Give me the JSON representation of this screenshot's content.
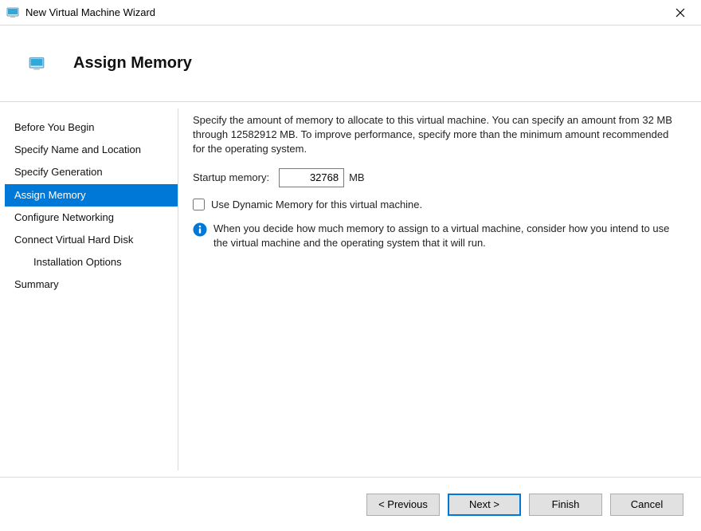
{
  "window": {
    "title": "New Virtual Machine Wizard"
  },
  "header": {
    "heading": "Assign Memory"
  },
  "sidebar": {
    "steps": [
      {
        "label": "Before You Begin"
      },
      {
        "label": "Specify Name and Location"
      },
      {
        "label": "Specify Generation"
      },
      {
        "label": "Assign Memory",
        "selected": true
      },
      {
        "label": "Configure Networking"
      },
      {
        "label": "Connect Virtual Hard Disk"
      },
      {
        "label": "Installation Options",
        "sub": true
      },
      {
        "label": "Summary"
      }
    ]
  },
  "content": {
    "description": "Specify the amount of memory to allocate to this virtual machine. You can specify an amount from 32 MB through 12582912 MB. To improve performance, specify more than the minimum amount recommended for the operating system.",
    "startup_label": "Startup memory:",
    "startup_value": "32768",
    "startup_unit": "MB",
    "dynamic_label": "Use Dynamic Memory for this virtual machine.",
    "dynamic_checked": false,
    "info_text": "When you decide how much memory to assign to a virtual machine, consider how you intend to use the virtual machine and the operating system that it will run."
  },
  "footer": {
    "previous": "< Previous",
    "next": "Next >",
    "finish": "Finish",
    "cancel": "Cancel"
  }
}
